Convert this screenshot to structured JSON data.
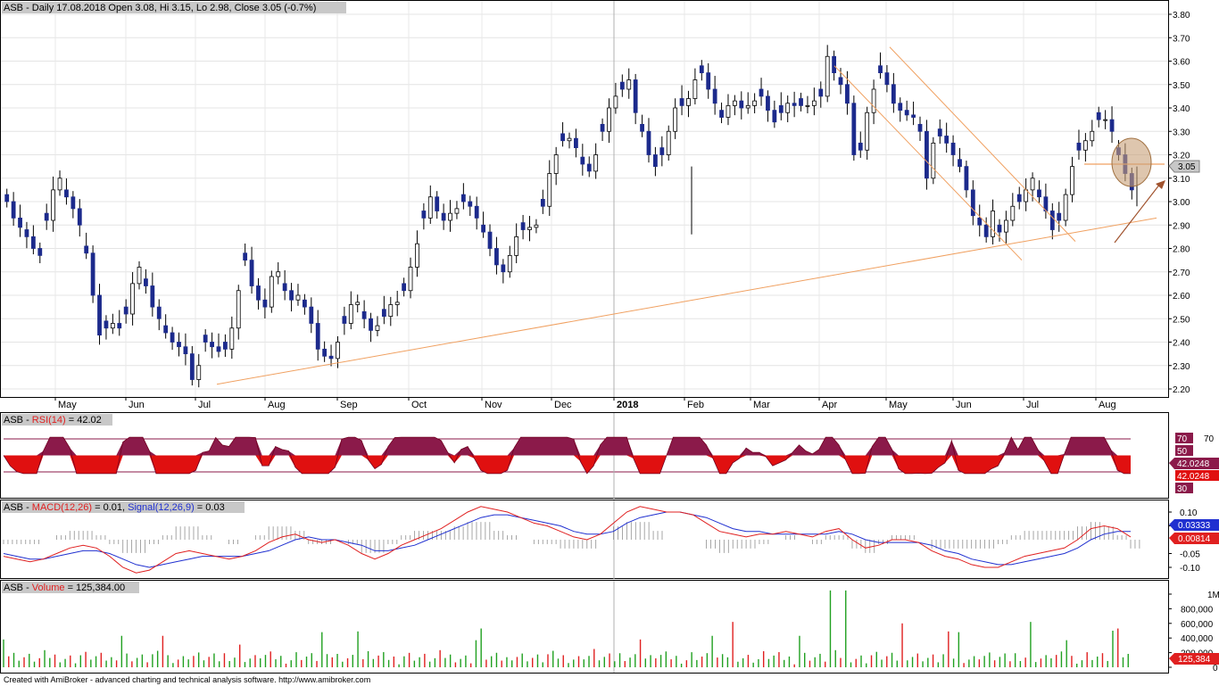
{
  "footer": "Created with AmiBroker - advanced charting and technical analysis software. http://www.amibroker.com",
  "colors": {
    "background": "#ffffff",
    "grid": "#d0d0d0",
    "up_candle": "#ffffff",
    "down_candle": "#1c2a8c",
    "trendline": "#f0a060",
    "arrow": "#a0522d",
    "circle_fill": "#c8a078",
    "rsi_fill": "#8b1a4a",
    "rsi_low_fill": "#e01010",
    "macd_line": "#e02020",
    "signal_line": "#2030d0",
    "volume_up": "#20a020",
    "volume_down": "#e02020"
  },
  "chart_data": [
    {
      "type": "candlestick",
      "title": "ASB - Daily 17.08.2018 Open 3.08, Hi 3.15, Lo 2.98, Close 3.05 (-0.7%)",
      "symbol": "ASB",
      "last": {
        "date": "17.08.2018",
        "open": 3.08,
        "high": 3.15,
        "low": 2.98,
        "close": 3.05,
        "change": "-0.7%"
      },
      "price_label": "3.05",
      "ylim": [
        2.15,
        3.85
      ],
      "yticks": [
        "3.80",
        "3.70",
        "3.60",
        "3.50",
        "3.40",
        "3.30",
        "3.20",
        "3.10",
        "3.00",
        "2.90",
        "2.80",
        "2.70",
        "2.60",
        "2.50",
        "2.40",
        "2.30",
        "2.20"
      ],
      "month_labels": [
        "May",
        "Jun",
        "Jul",
        "Aug",
        "Sep",
        "Oct",
        "Nov",
        "Dec",
        "2018",
        "Feb",
        "Mar",
        "Apr",
        "May",
        "Jun",
        "Jul",
        "Aug"
      ],
      "closes": [
        3.0,
        2.93,
        2.89,
        2.85,
        2.8,
        2.77,
        2.92,
        3.05,
        3.1,
        3.02,
        2.97,
        2.9,
        2.78,
        2.6,
        2.43,
        2.46,
        2.48,
        2.46,
        2.52,
        2.65,
        2.72,
        2.64,
        2.55,
        2.5,
        2.44,
        2.4,
        2.38,
        2.35,
        2.24,
        2.3,
        2.4,
        2.38,
        2.36,
        2.37,
        2.46,
        2.62,
        2.75,
        2.64,
        2.58,
        2.55,
        2.68,
        2.7,
        2.62,
        2.58,
        2.6,
        2.55,
        2.48,
        2.37,
        2.34,
        2.33,
        2.4,
        2.48,
        2.56,
        2.57,
        2.5,
        2.45,
        2.47,
        2.51,
        2.56,
        2.57,
        2.62,
        2.72,
        2.82,
        2.93,
        3.02,
        2.96,
        2.92,
        2.95,
        2.97,
        3.0,
        2.98,
        2.93,
        2.87,
        2.8,
        2.73,
        2.7,
        2.77,
        2.85,
        2.88,
        2.89,
        2.9,
        2.98,
        3.12,
        3.2,
        3.26,
        3.27,
        3.23,
        3.16,
        3.13,
        3.2,
        3.3,
        3.4,
        3.45,
        3.48,
        3.52,
        3.38,
        3.3,
        3.2,
        3.15,
        3.2,
        3.3,
        3.4,
        3.41,
        3.44,
        3.52,
        3.55,
        3.48,
        3.42,
        3.36,
        3.41,
        3.43,
        3.4,
        3.41,
        3.43,
        3.45,
        3.39,
        3.34,
        3.38,
        3.42,
        3.41,
        3.41,
        3.41,
        3.43,
        3.45,
        3.62,
        3.55,
        3.5,
        3.42,
        3.2,
        3.22,
        3.38,
        3.48,
        3.55,
        3.5,
        3.42,
        3.39,
        3.37,
        3.36,
        3.3,
        3.1,
        3.25,
        3.28,
        3.25,
        3.2,
        3.15,
        3.05,
        2.94,
        2.9,
        2.85,
        2.96,
        2.87,
        2.92,
        2.98,
        3.0,
        3.05,
        3.1,
        3.02,
        2.96,
        2.88,
        2.92,
        3.03,
        3.15,
        3.22,
        3.26,
        3.3,
        3.35,
        3.35,
        3.3,
        3.2,
        3.12,
        3.05
      ],
      "opens_offset_note": "",
      "trendlines": true
    },
    {
      "type": "area",
      "title": "ASB - RSI(14) = 42.02",
      "name_prefix": "ASB - ",
      "indicator": "RSI(14)",
      "value": "= 42.02",
      "ylim": [
        20,
        80
      ],
      "levels": [
        "70",
        "50",
        "30"
      ],
      "right_labels": {
        "top": "70",
        "mid": "50",
        "val": "42.0248",
        "val2": "42.0248",
        "low": "30"
      },
      "upper_band": 70,
      "lower_band": 30
    },
    {
      "type": "line",
      "title": "ASB - MACD(12,26) = 0.01, Signal(12,26,9) = 0.03",
      "name_prefix": "ASB - ",
      "indicator": "MACD(12,26)",
      "value": "= 0.01,",
      "signal_name": "Signal(12,26,9)",
      "signal_value": "= 0.03",
      "ylim": [
        -0.15,
        0.15
      ],
      "yticks": [
        "0.10",
        "0.05",
        "-0.05",
        "-0.10"
      ],
      "right_labels": {
        "signal": "0.03333",
        "macd": "0.00814"
      },
      "series": [
        {
          "name": "MACD(12,26)",
          "values": [
            -0.06,
            -0.07,
            -0.08,
            -0.07,
            -0.05,
            -0.03,
            -0.02,
            -0.03,
            -0.06,
            -0.1,
            -0.12,
            -0.11,
            -0.08,
            -0.05,
            -0.04,
            -0.05,
            -0.06,
            -0.07,
            -0.06,
            -0.04,
            -0.01,
            0.01,
            0.02,
            0.0,
            -0.01,
            0.0,
            -0.02,
            -0.05,
            -0.07,
            -0.05,
            -0.02,
            0.0,
            0.02,
            0.04,
            0.07,
            0.1,
            0.12,
            0.11,
            0.1,
            0.08,
            0.06,
            0.05,
            0.03,
            0.01,
            0.0,
            0.02,
            0.06,
            0.1,
            0.12,
            0.11,
            0.1,
            0.1,
            0.09,
            0.06,
            0.03,
            0.02,
            0.01,
            0.02,
            0.02,
            0.03,
            0.02,
            0.01,
            0.03,
            0.04,
            0.0,
            -0.03,
            -0.02,
            0.0,
            0.0,
            -0.01,
            -0.04,
            -0.06,
            -0.07,
            -0.09,
            -0.1,
            -0.1,
            -0.08,
            -0.06,
            -0.05,
            -0.04,
            -0.03,
            0.0,
            0.04,
            0.05,
            0.04,
            0.01
          ]
        },
        {
          "name": "Signal(12,26,9)",
          "values": [
            -0.05,
            -0.06,
            -0.07,
            -0.07,
            -0.06,
            -0.05,
            -0.04,
            -0.04,
            -0.05,
            -0.07,
            -0.09,
            -0.1,
            -0.09,
            -0.08,
            -0.07,
            -0.06,
            -0.06,
            -0.06,
            -0.06,
            -0.05,
            -0.04,
            -0.02,
            0.0,
            0.01,
            0.0,
            0.0,
            -0.01,
            -0.02,
            -0.04,
            -0.04,
            -0.03,
            -0.02,
            0.0,
            0.02,
            0.04,
            0.06,
            0.08,
            0.09,
            0.09,
            0.08,
            0.07,
            0.06,
            0.05,
            0.03,
            0.02,
            0.02,
            0.03,
            0.06,
            0.08,
            0.09,
            0.1,
            0.1,
            0.09,
            0.08,
            0.06,
            0.04,
            0.03,
            0.03,
            0.02,
            0.02,
            0.02,
            0.02,
            0.02,
            0.03,
            0.02,
            0.0,
            -0.01,
            -0.01,
            -0.01,
            -0.01,
            -0.02,
            -0.04,
            -0.05,
            -0.07,
            -0.08,
            -0.09,
            -0.09,
            -0.08,
            -0.07,
            -0.06,
            -0.05,
            -0.03,
            0.0,
            0.02,
            0.03,
            0.03
          ]
        }
      ]
    },
    {
      "type": "bar",
      "title": "ASB - Volume = 125,384.00",
      "name_prefix": "ASB - ",
      "indicator": "Volume",
      "value": "= 125,384.00",
      "ylim": [
        0,
        1100000
      ],
      "yticks": [
        "1M",
        "800,000",
        "600,000",
        "400,000",
        "200,000",
        "0"
      ],
      "right_label": "125,384",
      "spikes": [
        {
          "i": 131,
          "value": 1050000
        },
        {
          "i": 134,
          "value": 1050000
        },
        {
          "i": 116,
          "value": 620000
        },
        {
          "i": 143,
          "value": 600000
        },
        {
          "i": 163,
          "value": 620000
        },
        {
          "i": 176,
          "value": 500000
        }
      ]
    }
  ]
}
